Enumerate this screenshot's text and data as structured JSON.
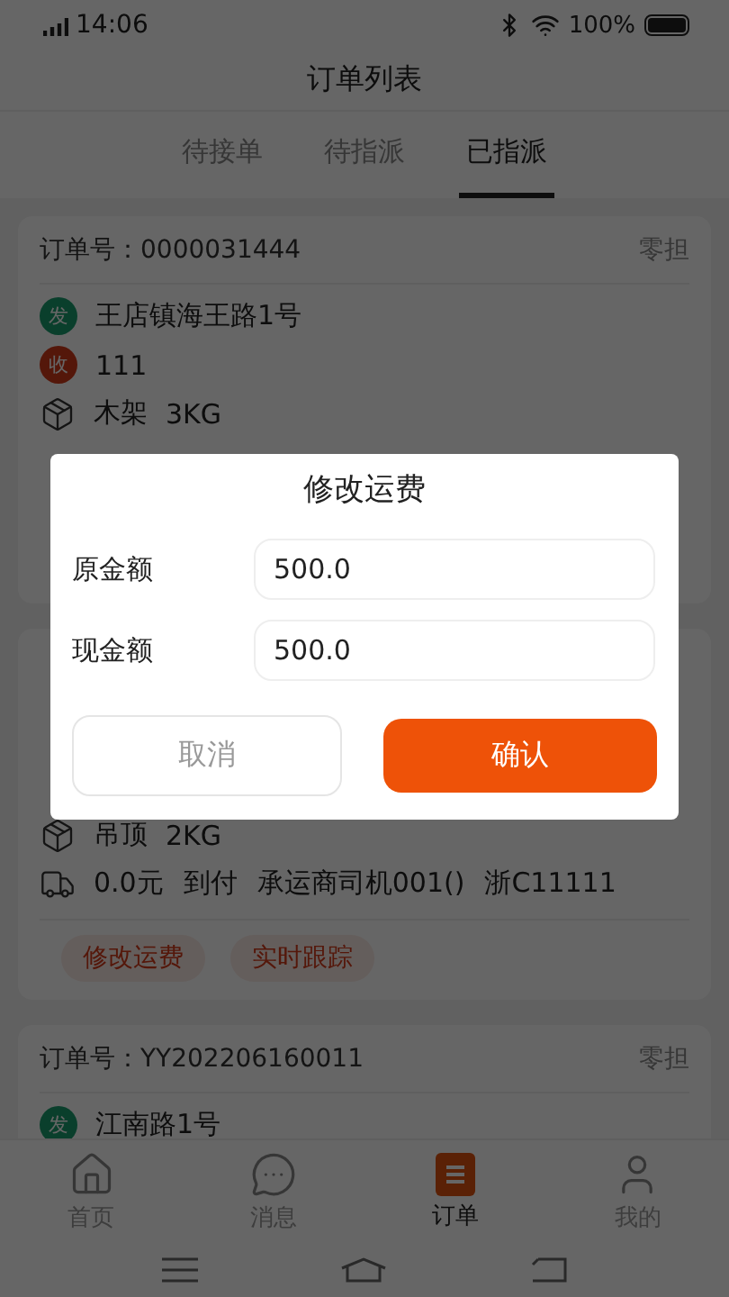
{
  "status_bar": {
    "time": "14:06",
    "battery": "100%"
  },
  "header": {
    "title": "订单列表"
  },
  "tabs": [
    {
      "label": "待接单",
      "selected": false
    },
    {
      "label": "待指派",
      "selected": false
    },
    {
      "label": "已指派",
      "selected": true
    }
  ],
  "orders": [
    {
      "number_label": "订单号：",
      "number": "0000031444",
      "type": "零担",
      "stops": [
        {
          "kind": "send",
          "badge": "发",
          "address": "王店镇海王路1号"
        },
        {
          "kind": "receive",
          "badge": "收",
          "address": "111"
        }
      ],
      "cargo": {
        "name": "木架",
        "weight": "3KG"
      }
    },
    {
      "cargo": {
        "name": "吊顶",
        "weight": "2KG"
      },
      "freight": [
        "0.0元",
        "到付",
        "承运商司机001()",
        "浙C11111"
      ],
      "actions": [
        "修改运费",
        "实时跟踪"
      ]
    },
    {
      "number_label": "订单号：",
      "number": "YY202206160011",
      "type": "零担",
      "stops": [
        {
          "kind": "send",
          "badge": "发",
          "address": "江南路1号"
        }
      ]
    }
  ],
  "bottom_tabs": [
    {
      "kind": "home",
      "label": "首页",
      "selected": false
    },
    {
      "kind": "message",
      "label": "消息",
      "selected": false
    },
    {
      "kind": "order",
      "label": "订单",
      "selected": true
    },
    {
      "kind": "profile",
      "label": "我的",
      "selected": false
    }
  ],
  "dialog": {
    "title": "修改运费",
    "fields": [
      {
        "label": "原金额",
        "value": "500.0"
      },
      {
        "label": "现金额",
        "value": "500.0"
      }
    ],
    "cancel": "取消",
    "confirm": "确认"
  }
}
